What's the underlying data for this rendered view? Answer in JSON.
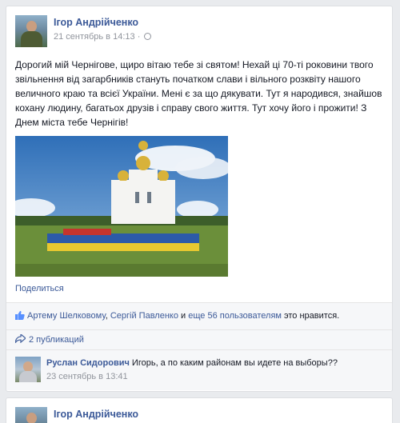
{
  "posts": [
    {
      "author": "Ігор Андрійченко",
      "timestamp": "21 сентябрь в 14:13",
      "separator": "·",
      "privacy_icon": "globe-icon",
      "text": "Дорогий мій Чернігове, щиро вітаю тебе зі святом! Нехай ці 70-ті роковини твого звільнення від загарбників стануть початком слави і вільного розквіту нашого величного краю та всієї України. Мені є за що дякувати. Тут я народився, знайшов кохану людину, багатьох друзів і справу свого життя. Тут хочу його і прожити! З Днем міста тебе Чернігів!",
      "share_label": "Поделиться",
      "likes": {
        "icon": "thumbs-up-icon",
        "person1": "Артему Шелковому",
        "sep1": ", ",
        "person2": "Сергій Павленко",
        "connector": " и ",
        "others": "еще 56 пользователям",
        "suffix": " это нравится."
      },
      "shares": {
        "icon": "share-arrow-icon",
        "label": "2 публикаций"
      },
      "comment": {
        "author": "Руслан Сидорович",
        "text": " Игорь, а по каким районам вы идете на выборы??",
        "timestamp": "23 сентябрь в 13:41"
      }
    },
    {
      "author": "Ігор Андрійченко"
    }
  ],
  "colors": {
    "background": "#e9ebee",
    "link": "#3b5998",
    "text": "#141823",
    "meta": "#90949c"
  }
}
